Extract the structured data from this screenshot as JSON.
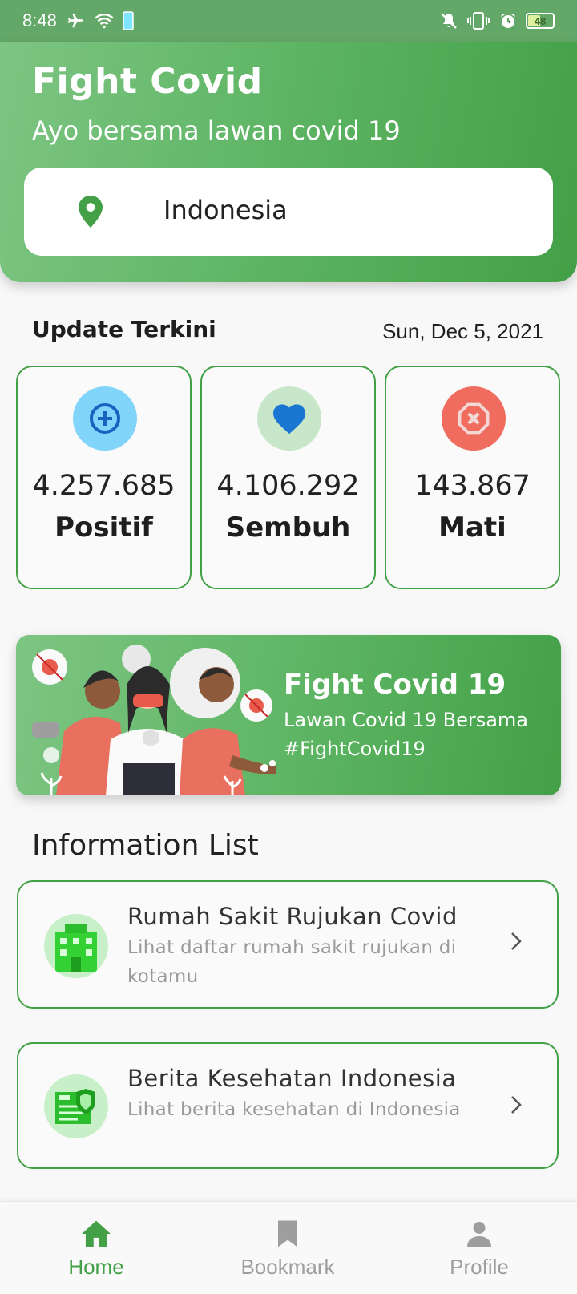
{
  "status_bar": {
    "time": "8:48",
    "battery": "48"
  },
  "header": {
    "title": "Fight Covid",
    "subtitle": "Ayo bersama lawan covid 19",
    "location": "Indonesia"
  },
  "update": {
    "title": "Update Terkini",
    "date": "Sun, Dec 5, 2021",
    "stats": [
      {
        "value": "4.257.685",
        "label": "Positif",
        "icon": "plus-circle-icon",
        "color": "#81d4fa",
        "icon_color": "#1565c0"
      },
      {
        "value": "4.106.292",
        "label": "Sembuh",
        "icon": "heart-icon",
        "color": "#c8e6c9",
        "icon_color": "#1976d2"
      },
      {
        "value": "143.867",
        "label": "Mati",
        "icon": "x-octagon-icon",
        "color": "#ef6c5f",
        "icon_color": "#ffffff"
      }
    ]
  },
  "banner": {
    "title": "Fight Covid 19",
    "line1": "Lawan Covid 19 Bersama",
    "line2": "#FightCovid19"
  },
  "info": {
    "title": "Information List",
    "items": [
      {
        "title": "Rumah Sakit Rujukan Covid",
        "desc": "Lihat daftar rumah sakit rujukan di kotamu"
      },
      {
        "title": "Berita Kesehatan Indonesia",
        "desc": "Lihat berita kesehatan di Indonesia"
      }
    ]
  },
  "nav": {
    "items": [
      {
        "label": "Home",
        "active": true
      },
      {
        "label": "Bookmark",
        "active": false
      },
      {
        "label": "Profile",
        "active": false
      }
    ]
  },
  "colors": {
    "primary": "#43a047",
    "inactive": "#9e9e9e"
  }
}
